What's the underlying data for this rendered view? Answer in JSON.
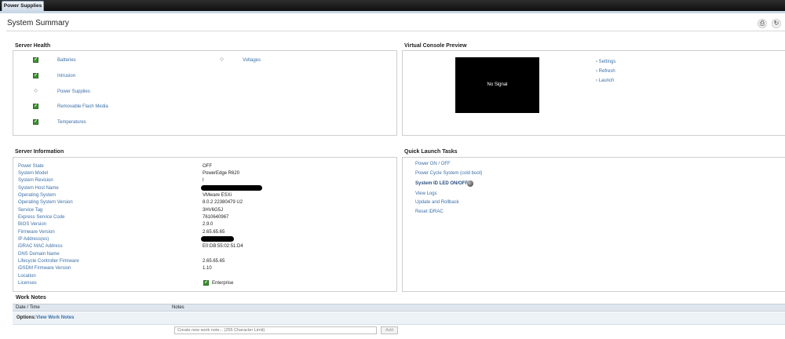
{
  "tab": {
    "label": "Power Supplies"
  },
  "page": {
    "title": "System Summary"
  },
  "server_health": {
    "title": "Server Health",
    "left_items": [
      {
        "label": "Batteries",
        "status": "ok"
      },
      {
        "label": "Intrusion",
        "status": "ok"
      },
      {
        "label": "Power Supplies",
        "status": "unknown"
      },
      {
        "label": "Removable Flash Media",
        "status": "ok"
      },
      {
        "label": "Temperatures",
        "status": "ok"
      }
    ],
    "right_items": [
      {
        "label": "Voltages",
        "status": "unknown"
      }
    ]
  },
  "virtual_console": {
    "title": "Virtual Console Preview",
    "screen_text": "No Signal",
    "links": [
      "Settings",
      "Refresh",
      "Launch"
    ]
  },
  "server_info": {
    "title": "Server Information",
    "rows": [
      {
        "label": "Power State",
        "value": "OFF"
      },
      {
        "label": "System Model",
        "value": "PowerEdge R620"
      },
      {
        "label": "System Revision",
        "value": "I"
      },
      {
        "label": "System Host Name",
        "value": ""
      },
      {
        "label": "Operating System",
        "value": "VMware ESXi"
      },
      {
        "label": "Operating System Version",
        "value": "8.0.2 22380479 U2"
      },
      {
        "label": "Service Tag",
        "value": "3HV6G5J"
      },
      {
        "label": "Express Service Code",
        "value": "7610640967"
      },
      {
        "label": "BIOS Version",
        "value": "2.9.0"
      },
      {
        "label": "Firmware Version",
        "value": "2.65.65.65"
      },
      {
        "label": "IP Address(es)",
        "value": ""
      },
      {
        "label": "iDRAC MAC Address",
        "value": "E0:DB:55:02:51:D4"
      },
      {
        "label": "DNS Domain Name",
        "value": ""
      },
      {
        "label": "Lifecycle Controller Firmware",
        "value": "2.65.65.65"
      },
      {
        "label": "iDSDM Firmware Version",
        "value": "1.10"
      },
      {
        "label": "Location",
        "value": ""
      },
      {
        "label": "Licenses",
        "value": "Enterprise"
      }
    ]
  },
  "quick_launch": {
    "title": "Quick Launch Tasks",
    "items": [
      "Power ON / OFF",
      "Power Cycle System (cold boot)",
      "System ID LED ON/OFF",
      "View Logs",
      "Update and Rollback",
      "Reset iDRAC"
    ]
  },
  "work_notes": {
    "title": "Work Notes",
    "col_date": "Date / Time",
    "col_notes": "Notes",
    "options_label": "Options:",
    "options_link": "View Work Notes",
    "input_placeholder": "Create new work note... (255 Character Limit)",
    "add_label": "Add"
  }
}
